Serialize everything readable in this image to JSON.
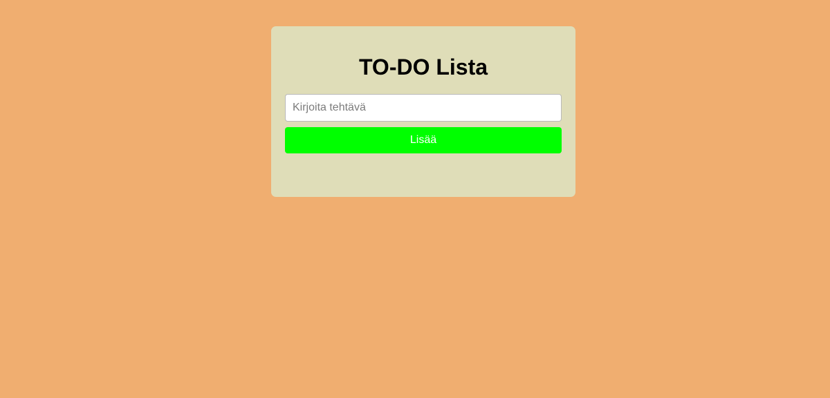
{
  "app": {
    "title": "TO-DO Lista"
  },
  "form": {
    "input_value": "",
    "input_placeholder": "Kirjoita tehtävä",
    "add_label": "Lisää"
  },
  "tasks": [],
  "colors": {
    "page_background": "#f0ae70",
    "card_background": "#dfddb8",
    "button_background": "#00ff00",
    "button_text": "#ffffff"
  }
}
